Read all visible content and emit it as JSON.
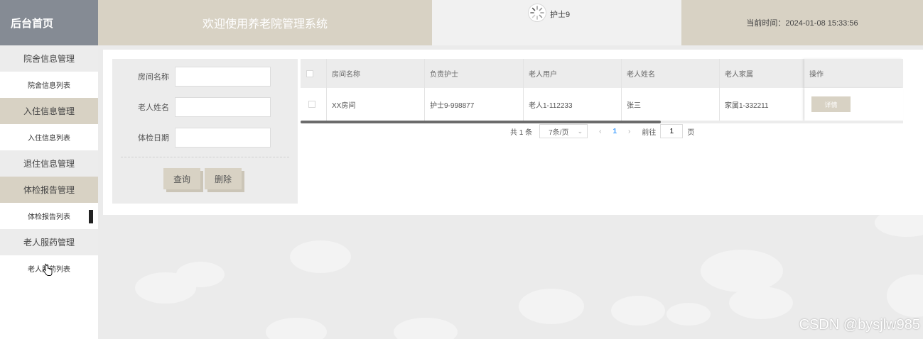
{
  "header": {
    "home_label": "后台首页",
    "system_title": "欢迎使用养老院管理系统",
    "username": "护士9",
    "current_time": "当前时间：2024-01-08 15:33:56"
  },
  "sidebar": {
    "items": [
      {
        "label": "院舍信息管理",
        "type": "group"
      },
      {
        "label": "院舍信息列表",
        "type": "sub"
      },
      {
        "label": "入住信息管理",
        "type": "group"
      },
      {
        "label": "入住信息列表",
        "type": "sub"
      },
      {
        "label": "退住信息管理",
        "type": "group"
      },
      {
        "label": "体检报告管理",
        "type": "group"
      },
      {
        "label": "体检报告列表",
        "type": "sub"
      },
      {
        "label": "老人服药管理",
        "type": "group"
      },
      {
        "label": "老人服药列表",
        "type": "sub"
      }
    ]
  },
  "search": {
    "fields": [
      {
        "label": "房间名称",
        "value": ""
      },
      {
        "label": "老人姓名",
        "value": ""
      },
      {
        "label": "体检日期",
        "value": ""
      }
    ],
    "query_button": "查询",
    "delete_button": "删除"
  },
  "table": {
    "columns": [
      "房间名称",
      "负责护士",
      "老人用户",
      "老人姓名",
      "老人家属",
      "操作"
    ],
    "rows": [
      {
        "room": "XX房间",
        "nurse": "护士9-998877",
        "elder_user": "老人1-112233",
        "elder_name": "张三",
        "family": "家属1-332211",
        "action": "详情"
      }
    ]
  },
  "pagination": {
    "total": "共 1 条",
    "page_size": "7条/页",
    "current_page": "1",
    "goto_label": "前往",
    "goto_value": "1",
    "page_unit": "页"
  },
  "watermark": "CSDN @bysjlw985",
  "colors": {
    "sidebar_header": "#858b94",
    "tan": "#d8d2c4",
    "grey": "#ececec",
    "pager_active": "#409eff"
  }
}
